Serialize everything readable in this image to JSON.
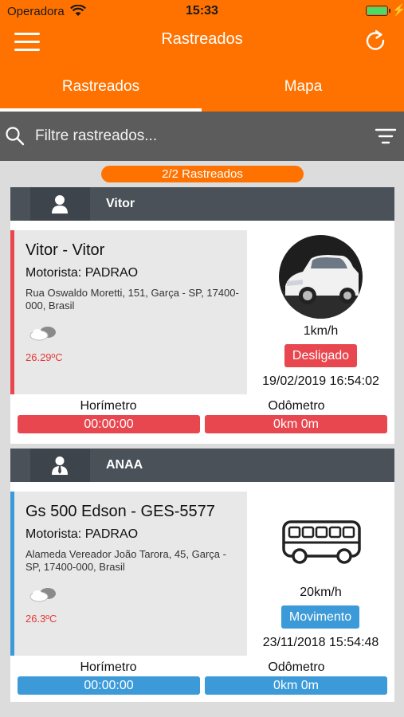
{
  "status_bar": {
    "carrier": "Operadora",
    "time": "15:33"
  },
  "header": {
    "title": "Rastreados",
    "menu_icon": "hamburger-menu-icon",
    "refresh_icon": "refresh-icon"
  },
  "tabs": [
    {
      "label": "Rastreados",
      "active": true
    },
    {
      "label": "Mapa",
      "active": false
    }
  ],
  "search": {
    "placeholder": "Filtre rastreados...",
    "value": ""
  },
  "counter": "2/2 Rastreados",
  "colors": {
    "brand": "#ff7200",
    "off": "#e8474f",
    "moving": "#3d9ad8",
    "header": "#4a5159"
  },
  "cards": [
    {
      "group_name": "Vitor",
      "avatar_icon": "user-icon",
      "vehicle_title": "Vitor - Vitor",
      "driver": "Motorista: PADRAO",
      "address": "Rua Oswaldo Moretti, 151, Garça - SP, 17400-000, Brasil",
      "weather_icon": "cloud-icon",
      "temperature": "26.29ºC",
      "vehicle_icon": "car-photo",
      "speed": "1km/h",
      "status": "Desligado",
      "status_color": "#e8474f",
      "datetime": "19/02/2019 16:54:02",
      "horimetro_label": "Horímetro",
      "horimetro_value": "00:00:00",
      "odometro_label": "Odômetro",
      "odometro_value": "0km 0m"
    },
    {
      "group_name": "ANAA",
      "avatar_icon": "businessman-icon",
      "vehicle_title": "Gs 500 Edson - GES-5577",
      "driver": "Motorista: PADRAO",
      "address": "Alameda Vereador João Tarora, 45, Garça - SP, 17400-000, Brasil",
      "weather_icon": "cloud-icon",
      "temperature": "26.3ºC",
      "vehicle_icon": "bus-icon",
      "speed": "20km/h",
      "status": "Movimento",
      "status_color": "#3d9ad8",
      "datetime": "23/11/2018 15:54:48",
      "horimetro_label": "Horímetro",
      "horimetro_value": "00:00:00",
      "odometro_label": "Odômetro",
      "odometro_value": "0km 0m"
    }
  ]
}
